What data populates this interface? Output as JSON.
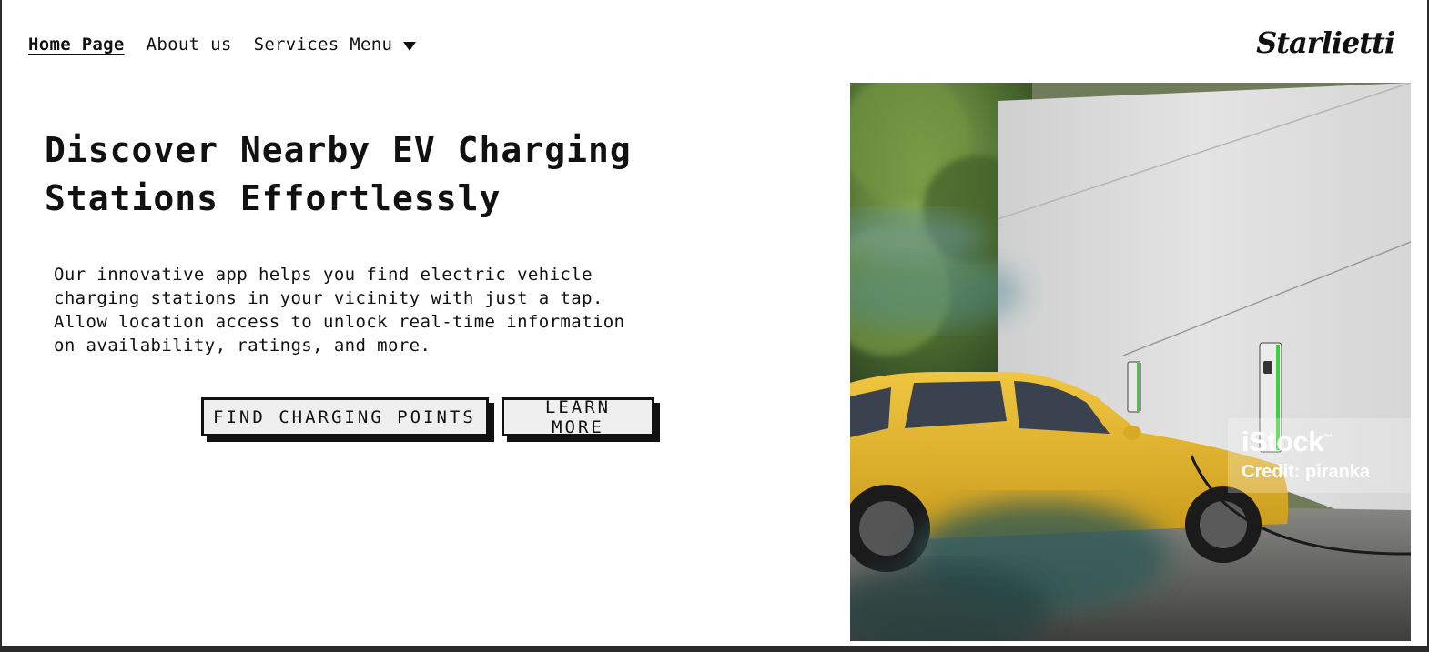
{
  "nav": {
    "items": [
      {
        "label": "Home Page",
        "active": true
      },
      {
        "label": "About us",
        "active": false
      },
      {
        "label": "Services Menu",
        "active": false
      }
    ]
  },
  "logo": {
    "text": "Starlietti"
  },
  "hero": {
    "headline_line1": "Discover Nearby EV Charging",
    "headline_line2": "Stations Effortlessly",
    "desc_line1": "Our innovative app helps you find electric vehicle",
    "desc_line2": "charging stations in your vicinity with just a tap.",
    "desc_line3": "Allow location access to unlock real-time information",
    "desc_line4": "on availability, ratings, and more.",
    "primary_button": "FIND CHARGING POINTS",
    "secondary_button": "LEARN MORE"
  },
  "photo": {
    "watermark_brand": "iStock",
    "watermark_tm": "™",
    "watermark_credit": "Credit: piranka"
  },
  "colors": {
    "car": "#e8b930",
    "wall": "#dedede",
    "foliage": "#5f7f3a",
    "charger_accent": "#3ecf3e"
  }
}
